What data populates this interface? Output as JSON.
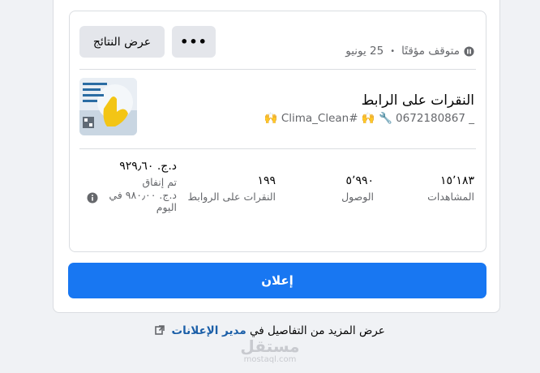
{
  "ad_card": {
    "status_label": "متوقف مؤقتًا",
    "date": "25 يونيو",
    "results_button": "عرض النتائج",
    "more_button": "•••",
    "ad_title": "النقرات على الرابط",
    "ad_subtitle": "_ 0672180867 🔧 🙌 #Clima_Clean 🙌",
    "metrics": {
      "views": {
        "value": "١٥٬١٨٣",
        "label": "المشاهدات"
      },
      "reach": {
        "value": "٥٬٩٩٠",
        "label": "الوصول"
      },
      "link_clicks": {
        "value": "١٩٩",
        "label": "النقرات على الروابط"
      },
      "spend": {
        "value": "د.ج. ٩٢٩٫٦٠",
        "label": "تم إنفاق",
        "daily": "د.ج. ٩٨٠٫٠٠ في اليوم"
      }
    }
  },
  "primary_button": "إعلان",
  "footer": {
    "prefix": "عرض المزيد من التفاصيل في",
    "link": "مدير الإعلانات"
  },
  "watermark": {
    "arabic": "مستقل",
    "latin": "mostaql.com"
  },
  "icons": {
    "status": "pause-circle-icon",
    "info": "info-circle-icon",
    "external": "external-link-icon"
  },
  "colors": {
    "primary": "#1877f2",
    "link": "#1b5fa8",
    "secondary_text": "#65676b",
    "button_grey": "#e4e6eb"
  }
}
